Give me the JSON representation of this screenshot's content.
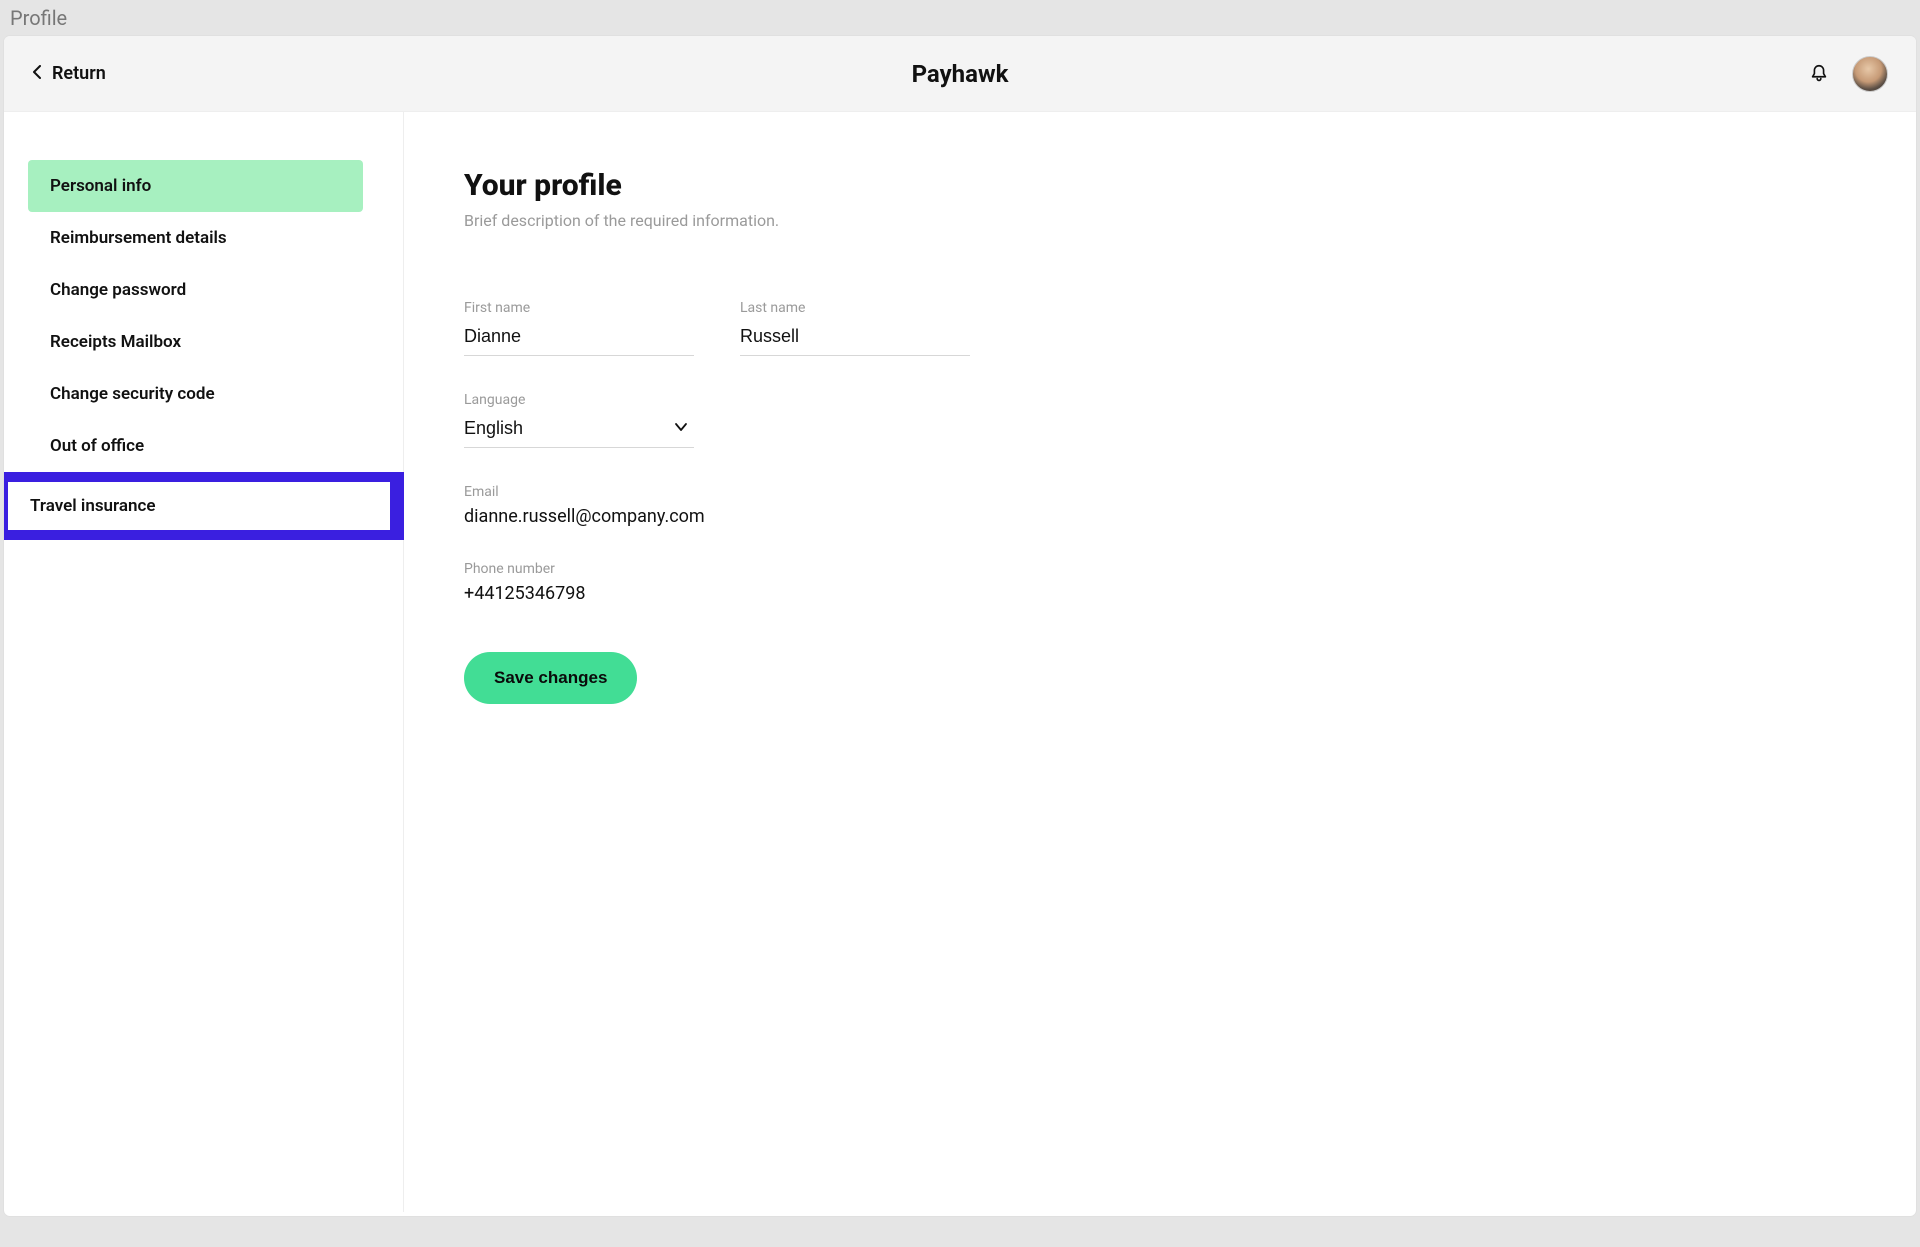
{
  "browser_tab": "Profile",
  "header": {
    "return_label": "Return",
    "brand": "Payhawk"
  },
  "sidebar": {
    "items": [
      {
        "label": "Personal info",
        "active": true
      },
      {
        "label": "Reimbursement details",
        "active": false
      },
      {
        "label": "Change password",
        "active": false
      },
      {
        "label": "Receipts Mailbox",
        "active": false
      },
      {
        "label": "Change security code",
        "active": false
      },
      {
        "label": "Out of office",
        "active": false
      },
      {
        "label": "Travel insurance",
        "active": false,
        "highlighted": true
      }
    ]
  },
  "profile": {
    "title": "Your profile",
    "subtitle": "Brief description of the required information.",
    "first_name_label": "First name",
    "first_name": "Dianne",
    "last_name_label": "Last name",
    "last_name": "Russell",
    "language_label": "Language",
    "language": "English",
    "email_label": "Email",
    "email": "dianne.russell@company.com",
    "phone_label": "Phone number",
    "phone": "+44125346798",
    "save_label": "Save changes"
  },
  "colors": {
    "accent_green": "#42dd95",
    "sidebar_active": "#a7f0c0",
    "callout_blue": "#3a1fe0"
  }
}
